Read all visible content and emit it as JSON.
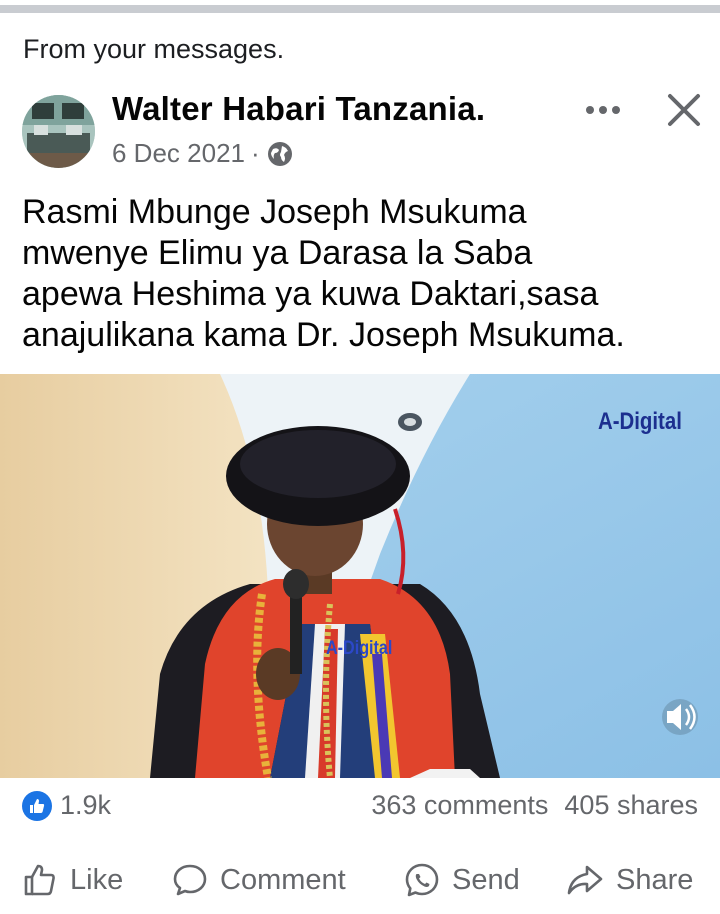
{
  "context_label": "From your messages.",
  "post": {
    "author": "Walter Habari Tanzania.",
    "date": "6 Dec 2021",
    "separator": "·",
    "text_lines": [
      "Rasmi Mbunge Joseph Msukuma",
      "mwenye Elimu ya Darasa la Saba",
      "apewa Heshima ya kuwa Daktari,sasa",
      "anajulikana kama Dr. Joseph Msukuma."
    ]
  },
  "media": {
    "watermark_top": "A-Digital",
    "watermark_center": "A-Digital"
  },
  "stats": {
    "reactions": "1.9k",
    "comments": "363 comments",
    "shares": "405 shares"
  },
  "actions": {
    "like": "Like",
    "comment": "Comment",
    "send": "Send",
    "share": "Share"
  },
  "icons": [
    "globe-icon",
    "more-icon",
    "close-icon",
    "like-icon",
    "comment-icon",
    "send-icon",
    "share-icon",
    "volume-icon"
  ],
  "colors": {
    "accent": "#1b74e4",
    "secondary_text": "#65676b",
    "divider": "#c9ccd1"
  }
}
